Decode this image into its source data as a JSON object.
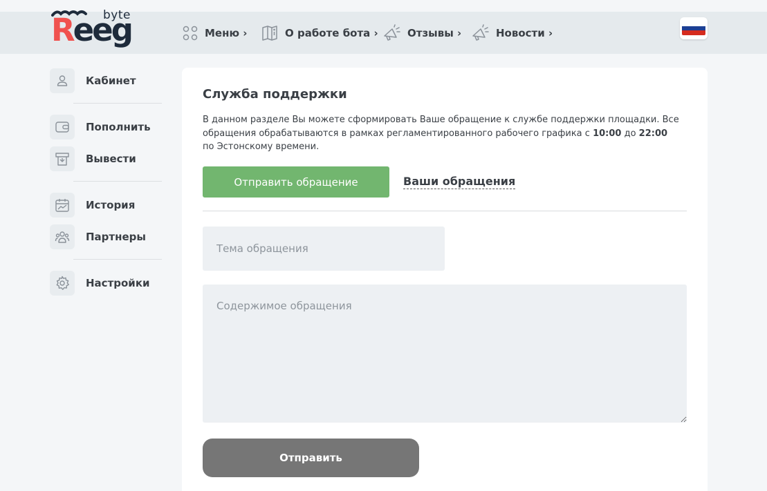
{
  "logo": {
    "main": "Reeg",
    "first_letter": "R",
    "rest": "eeg",
    "sub": "byte",
    "brand_colors": {
      "accent": "#f0524f",
      "dark": "#1e2b3b"
    }
  },
  "nav": {
    "items": [
      {
        "label": "Меню ›",
        "icon": "grid-icon"
      },
      {
        "label": "О работе бота ›",
        "icon": "book-info-icon"
      },
      {
        "label": "Отзывы ›",
        "icon": "megaphone-icon"
      },
      {
        "label": "Новости ›",
        "icon": "megaphone-icon"
      }
    ],
    "language": "ru",
    "language_flag_colors": [
      "#ffffff",
      "#1c3f94",
      "#d52b1e"
    ]
  },
  "sidebar": {
    "items": [
      {
        "label": "Кабинет",
        "icon": "user-icon"
      },
      {
        "label": "Пополнить",
        "icon": "wallet-icon"
      },
      {
        "label": "Вывести",
        "icon": "withdraw-icon"
      },
      {
        "label": "История",
        "icon": "calendar-chart-icon"
      },
      {
        "label": "Партнеры",
        "icon": "partners-icon"
      },
      {
        "label": "Настройки",
        "icon": "gear-icon"
      }
    ]
  },
  "support": {
    "title": "Служба поддержки",
    "desc_part1": "В данном разделе Вы можете сформировать Ваше обращение к службе поддержки площадки. Все обращения обрабатываются в рамках регламентированного рабочего графика с ",
    "time_from": "10:00",
    "desc_part2": " до ",
    "time_to": "22:00",
    "desc_part3": " по Эстонскому времени.",
    "send_request_button": "Отправить обращение",
    "my_requests_link": "Ваши обращения",
    "subject_placeholder": "Тема обращения",
    "content_placeholder": "Содержимое обращения",
    "submit_button": "Отправить",
    "colors": {
      "primary_green": "#72b66f",
      "submit_gray": "#767676",
      "field_bg": "#edf0f3"
    }
  }
}
